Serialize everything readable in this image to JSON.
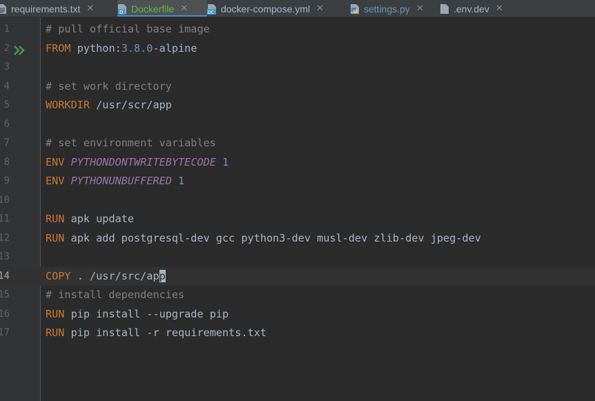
{
  "tabs": [
    {
      "label": "requirements.txt",
      "icon": "text-file-icon",
      "color": "#a9b7c6",
      "active": false
    },
    {
      "label": "Dockerfile",
      "icon": "dockerfile-icon",
      "color": "#62b543",
      "active": true
    },
    {
      "label": "docker-compose.yml",
      "icon": "docker-compose-icon",
      "color": "#a9b7c6",
      "active": false
    },
    {
      "label": "settings.py",
      "icon": "python-file-icon",
      "color": "#6897bb",
      "active": false
    },
    {
      "label": ".env.dev",
      "icon": "env-file-icon",
      "color": "#a9b7c6",
      "active": false
    }
  ],
  "close_glyph": "✕",
  "current_line": 14,
  "run_line": 2,
  "lines": [
    {
      "n": "1",
      "code": [
        [
          "cm",
          "# pull official base image"
        ]
      ]
    },
    {
      "n": "2",
      "code": [
        [
          "kw",
          "FROM"
        ],
        [
          "",
          " python:"
        ],
        [
          "num",
          "3.8.0"
        ],
        [
          "",
          "-alpine"
        ]
      ]
    },
    {
      "n": "3",
      "code": []
    },
    {
      "n": "4",
      "code": [
        [
          "cm",
          "# set work directory"
        ]
      ]
    },
    {
      "n": "5",
      "code": [
        [
          "kw",
          "WORKDIR"
        ],
        [
          "",
          " /usr/scr/app"
        ]
      ]
    },
    {
      "n": "6",
      "code": []
    },
    {
      "n": "7",
      "code": [
        [
          "cm",
          "# set environment variables"
        ]
      ]
    },
    {
      "n": "8",
      "code": [
        [
          "kw",
          "ENV"
        ],
        [
          "",
          " "
        ],
        [
          "ev",
          "PYTHONDONTWRITEBYTECODE"
        ],
        [
          "",
          " "
        ],
        [
          "num",
          "1"
        ]
      ]
    },
    {
      "n": "9",
      "code": [
        [
          "kw",
          "ENV"
        ],
        [
          "",
          " "
        ],
        [
          "ev",
          "PYTHONUNBUFFERED"
        ],
        [
          "",
          " "
        ],
        [
          "num",
          "1"
        ]
      ]
    },
    {
      "n": "10",
      "code": []
    },
    {
      "n": "11",
      "code": [
        [
          "kw",
          "RUN"
        ],
        [
          "",
          " apk update"
        ]
      ]
    },
    {
      "n": "12",
      "code": [
        [
          "kw",
          "RUN"
        ],
        [
          "",
          " apk add postgresql-dev gcc python3-dev musl-dev zlib-dev jpeg-dev"
        ]
      ]
    },
    {
      "n": "13",
      "code": []
    },
    {
      "n": "14",
      "code": [
        [
          "kw",
          "COPY"
        ],
        [
          "",
          " . /usr/src/ap"
        ],
        [
          "caret-char",
          "p"
        ]
      ]
    },
    {
      "n": "15",
      "code": [
        [
          "cm",
          "# install dependencies"
        ]
      ]
    },
    {
      "n": "16",
      "code": [
        [
          "kw",
          "RUN"
        ],
        [
          "",
          " pip install --upgrade pip"
        ]
      ]
    },
    {
      "n": "17",
      "code": [
        [
          "kw",
          "RUN"
        ],
        [
          "",
          " pip install -r requirements.txt"
        ]
      ]
    }
  ]
}
